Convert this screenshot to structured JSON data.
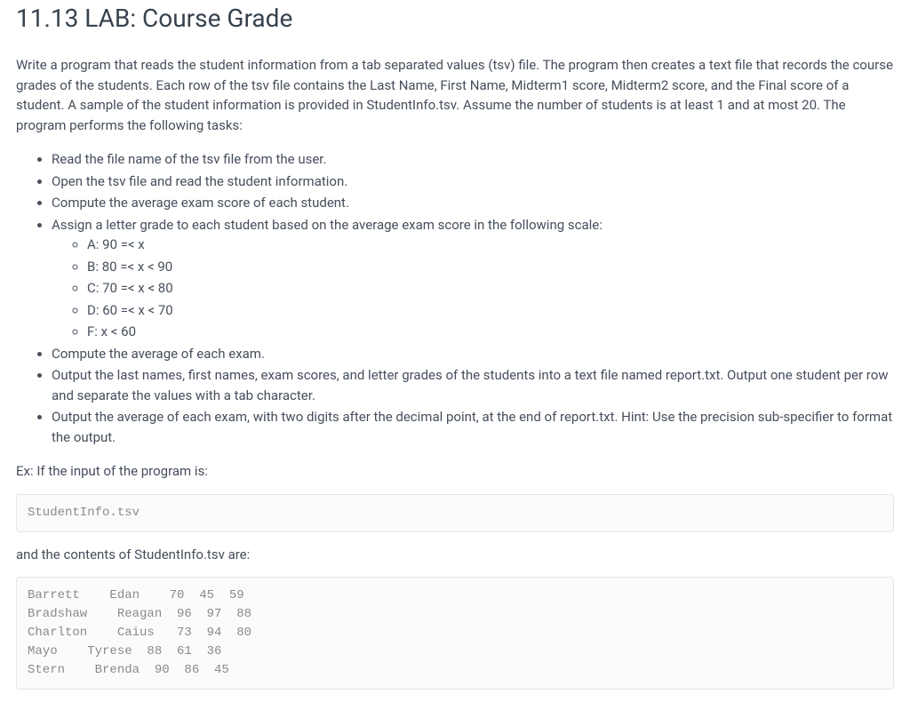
{
  "title": "11.13 LAB: Course Grade",
  "intro": "Write a program that reads the student information from a tab separated values (tsv) file. The program then creates a text file that records the course grades of the students. Each row of the tsv file contains the Last Name, First Name, Midterm1 score, Midterm2 score, and the Final score of a student. A sample of the student information is provided in StudentInfo.tsv. Assume the number of students is at least 1 and at most 20. The program performs the following tasks:",
  "tasks": {
    "t1": "Read the file name of the tsv file from the user.",
    "t2": "Open the tsv file and read the student information.",
    "t3": "Compute the average exam score of each student.",
    "t4": "Assign a letter grade to each student based on the average exam score in the following scale:",
    "scale": {
      "a": "A: 90 =< x",
      "b": "B: 80 =< x < 90",
      "c": "C: 70 =< x < 80",
      "d": "D: 60 =< x < 70",
      "f": "F: x < 60"
    },
    "t5": "Compute the average of each exam.",
    "t6": "Output the last names, first names, exam scores, and letter grades of the students into a text file named report.txt. Output one student per row and separate the values with a tab character.",
    "t7": "Output the average of each exam, with two digits after the decimal point, at the end of report.txt. Hint: Use the precision sub-specifier to format the output."
  },
  "example_label_1": "Ex: If the input of the program is:",
  "code1": "StudentInfo.tsv",
  "example_label_2": "and the contents of StudentInfo.tsv are:",
  "code2": "Barrett    Edan    70  45  59\nBradshaw    Reagan  96  97  88\nCharlton    Caius   73  94  80\nMayo    Tyrese  88  61  36\nStern    Brenda  90  86  45"
}
